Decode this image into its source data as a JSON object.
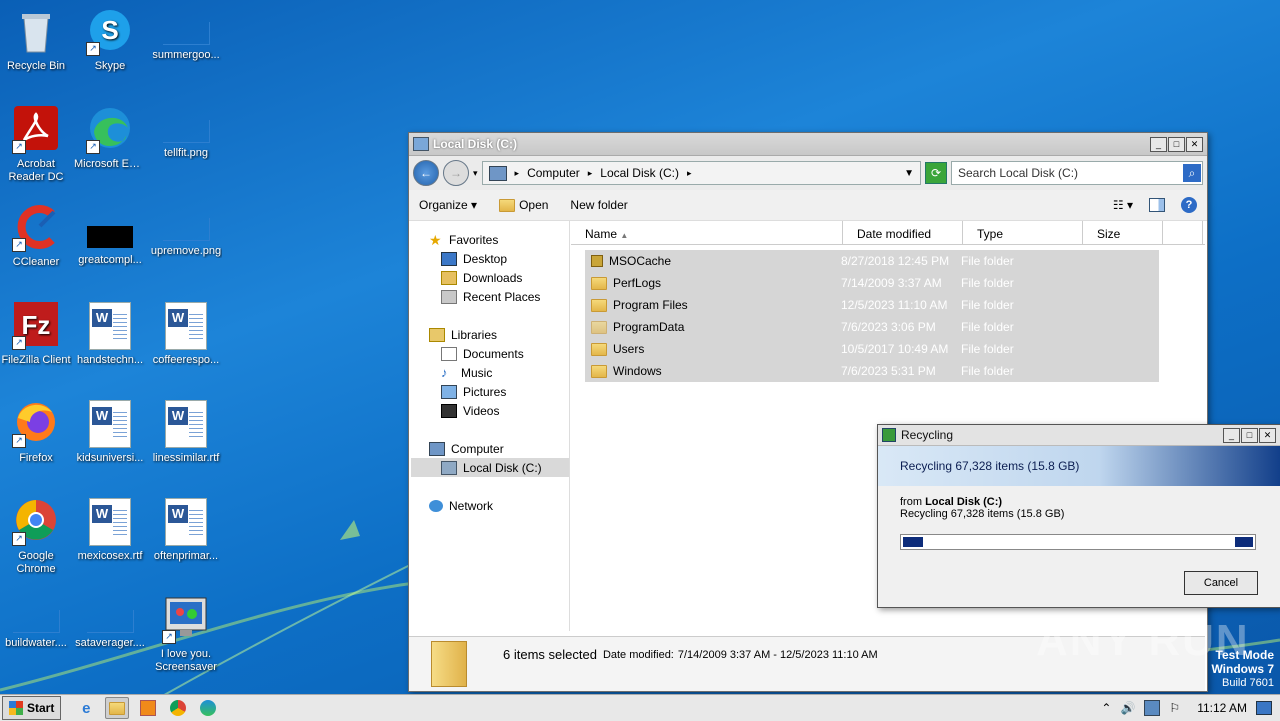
{
  "desktop": {
    "icons": [
      {
        "label": "Recycle Bin"
      },
      {
        "label": "Skype"
      },
      {
        "label": "summergoo..."
      },
      {
        "label": "Acrobat Reader DC"
      },
      {
        "label": "Microsoft Edge"
      },
      {
        "label": "tellfit.png"
      },
      {
        "label": "CCleaner"
      },
      {
        "label": "greatcompl..."
      },
      {
        "label": "upremove.png"
      },
      {
        "label": "FileZilla Client"
      },
      {
        "label": "handstechn..."
      },
      {
        "label": "coffeerespo..."
      },
      {
        "label": "Firefox"
      },
      {
        "label": "kidsuniversi..."
      },
      {
        "label": "linessimilar.rtf"
      },
      {
        "label": "Google Chrome"
      },
      {
        "label": "mexicosex.rtf"
      },
      {
        "label": "oftenprimar..."
      },
      {
        "label": "buildwater...."
      },
      {
        "label": "sataverager...."
      },
      {
        "label": "I love you. Screensaver"
      }
    ]
  },
  "explorer": {
    "title": "Local Disk (C:)",
    "breadcrumb": [
      "Computer",
      "Local Disk (C:)"
    ],
    "search_placeholder": "Search Local Disk (C:)",
    "toolbar": {
      "organize": "Organize",
      "open": "Open",
      "new_folder": "New folder"
    },
    "nav": {
      "favorites": "Favorites",
      "desktop": "Desktop",
      "downloads": "Downloads",
      "recent": "Recent Places",
      "libraries": "Libraries",
      "documents": "Documents",
      "music": "Music",
      "pictures": "Pictures",
      "videos": "Videos",
      "computer": "Computer",
      "local_disk": "Local Disk (C:)",
      "network": "Network"
    },
    "columns": {
      "name": "Name",
      "date": "Date modified",
      "type": "Type",
      "size": "Size"
    },
    "rows": [
      {
        "name": "MSOCache",
        "date": "8/27/2018 12:45 PM",
        "type": "File folder"
      },
      {
        "name": "PerfLogs",
        "date": "7/14/2009 3:37 AM",
        "type": "File folder"
      },
      {
        "name": "Program Files",
        "date": "12/5/2023 11:10 AM",
        "type": "File folder"
      },
      {
        "name": "ProgramData",
        "date": "7/6/2023 3:06 PM",
        "type": "File folder"
      },
      {
        "name": "Users",
        "date": "10/5/2017 10:49 AM",
        "type": "File folder"
      },
      {
        "name": "Windows",
        "date": "7/6/2023 5:31 PM",
        "type": "File folder"
      }
    ],
    "details": {
      "selected": "6 items selected",
      "date_label": "Date modified:",
      "date_range": "7/14/2009 3:37 AM - 12/5/2023 11:10 AM"
    }
  },
  "dialog": {
    "title": "Recycling",
    "header": "Recycling 67,328 items (15.8 GB)",
    "from_label": "from",
    "from_value": "Local Disk (C:)",
    "status": "Recycling 67,328 items (15.8 GB)",
    "cancel": "Cancel"
  },
  "taskbar": {
    "start": "Start",
    "clock": "11:12 AM"
  },
  "watermark": {
    "text": "ANY RUN"
  },
  "testmode": {
    "line1": "Test Mode",
    "line2": "Windows 7",
    "line3": "Build 7601"
  },
  "colors": {
    "selection": "#d6d6d6",
    "progress": "#0d2c7a",
    "desktop": "#1d84d8"
  }
}
